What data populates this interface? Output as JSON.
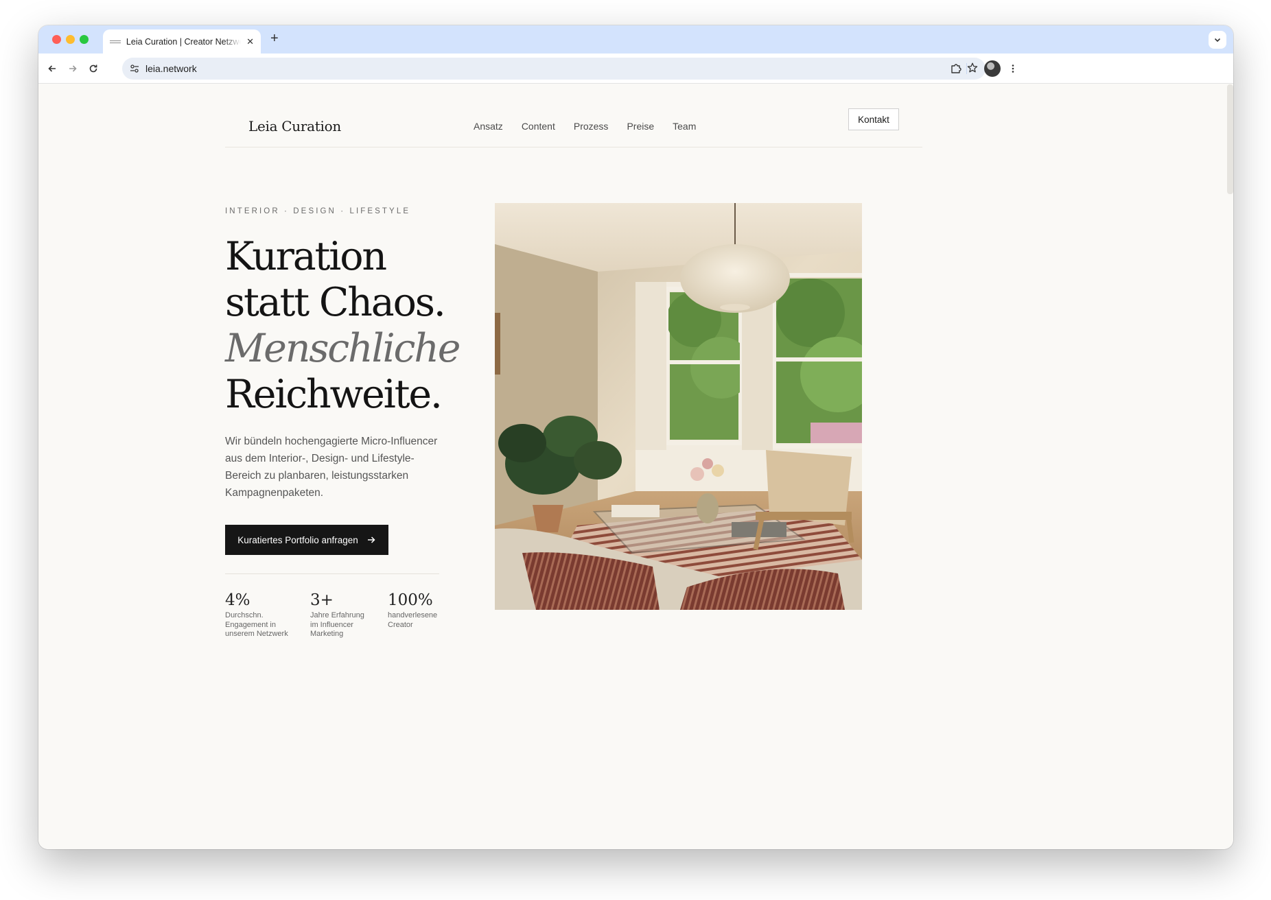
{
  "browser": {
    "tab_title": "Leia Curation | Creator Netzwerk",
    "url": "leia.network"
  },
  "header": {
    "logo": "Leia Curation",
    "nav": [
      "Ansatz",
      "Content",
      "Prozess",
      "Preise",
      "Team"
    ],
    "contact_label": "Kontakt"
  },
  "hero": {
    "eyebrow": "INTERIOR · DESIGN · LIFESTYLE",
    "headline_line1": "Kuration",
    "headline_line2": "statt Chaos.",
    "headline_line3_italic": "Menschliche",
    "headline_line4": "Reichweite.",
    "lead": "Wir bündeln hochengagierte Micro-Influencer aus dem Interior-, Design- und Lifestyle-Bereich zu planbaren, leistungsstarken Kampagnenpaketen.",
    "cta_label": "Kuratiertes Portfolio anfragen",
    "stats": [
      {
        "value": "4%",
        "label": "Durchschn. Engagement in unserem Netzwerk"
      },
      {
        "value": "3+",
        "label": "Jahre Erfahrung im Influencer Marketing"
      },
      {
        "value": "100%",
        "label": "handverlesene Creator"
      }
    ]
  },
  "colors": {
    "page_bg": "#faf9f6",
    "tabbar_bg": "#d3e3fd",
    "cta_bg": "#161616",
    "accent_italic": "#6b6b6b"
  }
}
